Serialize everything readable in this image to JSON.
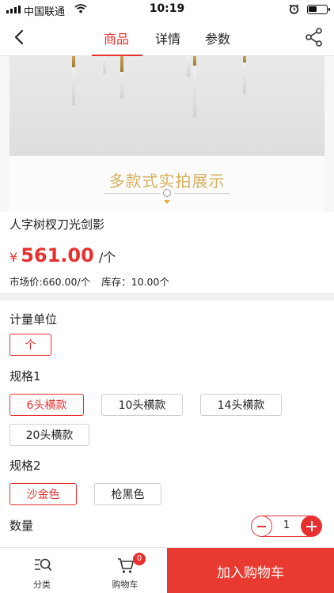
{
  "status_bar": {
    "carrier": "中国联通",
    "time": "10:19"
  },
  "nav": {
    "tabs": [
      {
        "label": "商品",
        "active": true
      },
      {
        "label": "详情",
        "active": false
      },
      {
        "label": "参数",
        "active": false
      }
    ],
    "accent_color": "#e83030"
  },
  "hero": {
    "banner_text": "多款式实拍展示"
  },
  "product": {
    "name": "人字树杈刀光剑影",
    "price_symbol": "¥",
    "price": "561.00",
    "price_unit": "/个",
    "market_price": "市场价:660.00/个",
    "stock": "库存：10.00个"
  },
  "options": {
    "unit": {
      "label": "计量单位",
      "choices": [
        {
          "label": "个",
          "selected": true
        }
      ]
    },
    "spec1": {
      "label": "规格1",
      "choices": [
        {
          "label": "6头横款",
          "selected": true
        },
        {
          "label": "10头横款",
          "selected": false
        },
        {
          "label": "14头横款",
          "selected": false
        },
        {
          "label": "20头横款",
          "selected": false
        }
      ]
    },
    "spec2": {
      "label": "规格2",
      "choices": [
        {
          "label": "沙金色",
          "selected": true
        },
        {
          "label": "枪黑色",
          "selected": false
        }
      ]
    },
    "quantity": {
      "label": "数量",
      "value": "1"
    }
  },
  "bottom_bar": {
    "category_label": "分类",
    "cart_label": "购物车",
    "cart_badge": "0",
    "add_to_cart_label": "加入购物车",
    "add_to_cart_color": "#e83a30"
  }
}
